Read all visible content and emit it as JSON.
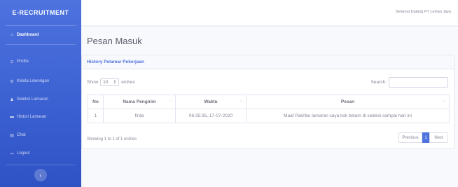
{
  "sidebar": {
    "brand": "E-RECRUITMENT",
    "items": [
      {
        "icon": "home-icon",
        "glyph": "⌂",
        "label": "Dashboard",
        "active": true
      },
      {
        "icon": "user-circle-icon",
        "glyph": "⊙",
        "label": "Profile"
      },
      {
        "icon": "gear-icon",
        "glyph": "⚙",
        "label": "Kelola Lowongan"
      },
      {
        "icon": "user-icon",
        "glyph": "♟",
        "label": "Seleksi Lamaran"
      },
      {
        "icon": "folder-icon",
        "glyph": "▬",
        "label": "Histori Lamaran"
      },
      {
        "icon": "chat-icon",
        "glyph": "▤",
        "label": "Chat"
      },
      {
        "icon": "logout-icon",
        "glyph": "↦",
        "label": "Logout"
      }
    ],
    "toggle_glyph": "‹"
  },
  "topbar": {
    "greeting": "Selamat Datang PT Lestari Jaya"
  },
  "page": {
    "title": "Pesan Masuk"
  },
  "card": {
    "header": "History Pelamar Pekerjaan"
  },
  "table_controls": {
    "show_label": "Show",
    "entries_value": "10",
    "entries_label": "entries",
    "search_label": "Search:"
  },
  "table": {
    "columns": [
      "No",
      "Nama Pengirim",
      "Waktu",
      "Pesan"
    ],
    "rows": [
      [
        "1",
        "firda",
        "06:35:35, 17-07-2020",
        "Maaf Pak/Ibu lamaran saya kok belum di seleksi sampai hari ini"
      ]
    ]
  },
  "footer": {
    "info": "Showing 1 to 1 of 1 entries",
    "prev": "Previous",
    "page": "1",
    "next": "Next"
  },
  "colors": {
    "primary": "#4e73df",
    "background": "#f8f9fc",
    "text_muted": "#858796"
  }
}
